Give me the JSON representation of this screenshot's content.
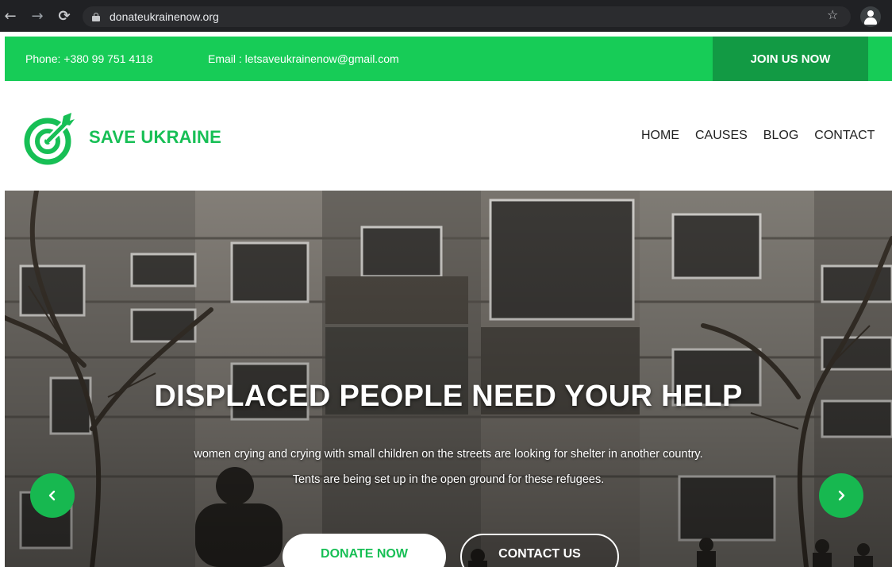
{
  "browser": {
    "url": "donateukrainenow.org"
  },
  "topbar": {
    "phone": "Phone: +380 99 751 4118",
    "email": "Email : letsaveukrainenow@gmail.com",
    "join_label": "JOIN US NOW"
  },
  "header": {
    "brand": "SAVE UKRAINE",
    "nav": [
      {
        "label": "HOME"
      },
      {
        "label": "CAUSES"
      },
      {
        "label": "BLOG"
      },
      {
        "label": "CONTACT"
      }
    ]
  },
  "hero": {
    "title": "DISPLACED PEOPLE NEED YOUR HELP",
    "line1": "women crying and crying with small children on the streets are looking for shelter in another country.",
    "line2": "Tents are being set up in the open ground for these refugees.",
    "donate_label": "DONATE NOW",
    "contact_label": "CONTACT US"
  },
  "colors": {
    "brand_green": "#17cc57",
    "dark_green": "#129a44",
    "browser_dark": "#202124"
  },
  "icons": {
    "back": "back-arrow-icon",
    "forward": "forward-arrow-icon",
    "reload": "reload-icon",
    "lock": "lock-icon",
    "star": "star-icon",
    "profile": "profile-icon",
    "logo": "target-arrow-logo-icon",
    "prev": "chevron-left-icon",
    "next": "chevron-right-icon"
  }
}
